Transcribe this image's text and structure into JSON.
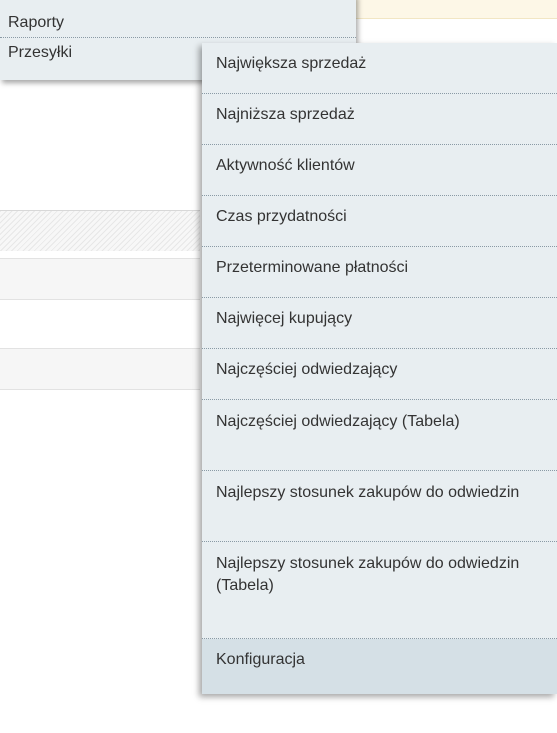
{
  "main_menu": {
    "items": [
      "Raporty",
      "Przesyłki"
    ]
  },
  "reports_submenu": {
    "items": [
      "Największa sprzedaż",
      "Najniższa sprzedaż",
      "Aktywność klientów",
      "Czas przydatności",
      "Przeterminowane płatności",
      "Najwięcej kupujący",
      "Najczęściej odwiedzający",
      "Najczęściej odwiedzający (Tabela)",
      "Najlepszy stosunek zakupów do odwiedzin",
      "Najlepszy stosunek zakupów do odwiedzin (Tabela)",
      "Konfiguracja"
    ]
  },
  "colors": {
    "menu_bg": "#e8eef1",
    "highlight_bg": "#d5e0e6",
    "text": "#333333"
  }
}
